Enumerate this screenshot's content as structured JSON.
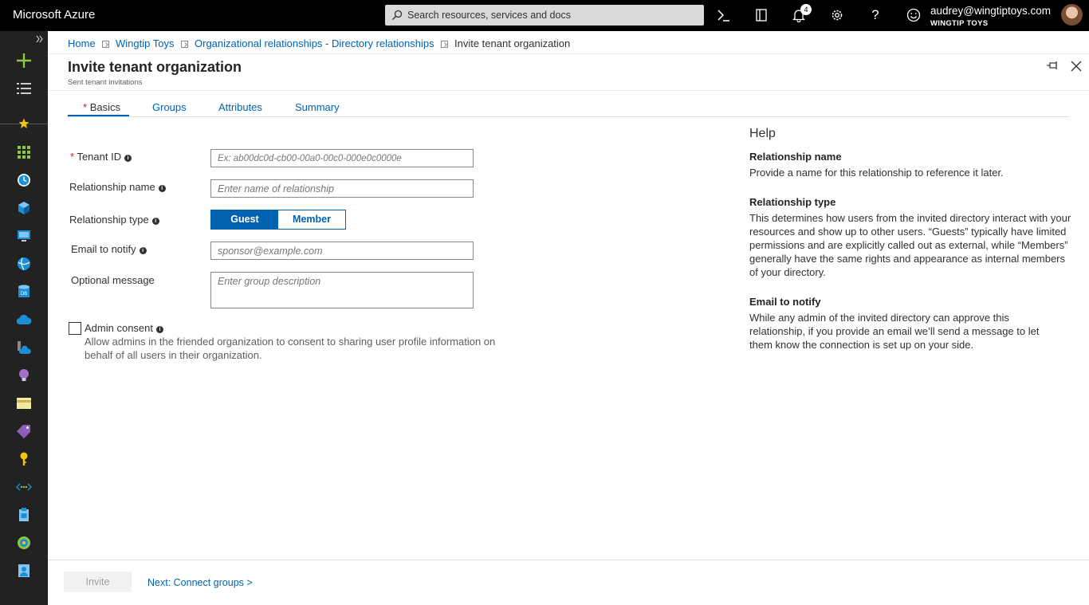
{
  "topbar": {
    "brand": "Microsoft Azure",
    "search_placeholder": "Search resources, services and docs",
    "notification_count": "4",
    "user_email": "audrey@wingtiptoys.com",
    "user_org": "WINGTIP TOYS"
  },
  "breadcrumb": {
    "items": [
      "Home",
      "Wingtip Toys",
      "Organizational relationships - Directory relationships"
    ],
    "current": "Invite tenant organization"
  },
  "page": {
    "title": "Invite tenant organization",
    "subtitle": "Sent tenant invitations"
  },
  "tabs": [
    {
      "label": "Basics",
      "required": "*"
    },
    {
      "label": "Groups"
    },
    {
      "label": "Attributes"
    },
    {
      "label": "Summary"
    }
  ],
  "form": {
    "tenant_id": {
      "required": "*",
      "label": "Tenant ID",
      "placeholder": "Ex: ab00dc0d-cb00-00a0-00c0-000e0c0000e"
    },
    "relationship_name": {
      "label": "Relationship name",
      "placeholder": "Enter name of relationship"
    },
    "relationship_type": {
      "label": "Relationship type",
      "options": [
        "Guest",
        "Member"
      ],
      "selected": "Guest"
    },
    "email": {
      "label": "Email to notify",
      "placeholder": "sponsor@example.com"
    },
    "message": {
      "label": "Optional message",
      "placeholder": "Enter group description"
    },
    "consent": {
      "label": "Admin consent",
      "checked": false,
      "description": "Allow admins in the friended organization to consent to sharing user profile information on behalf of all users in their organization."
    }
  },
  "help": {
    "title": "Help",
    "sections": [
      {
        "heading": "Relationship name",
        "body": "Provide a name for this relationship to reference it later."
      },
      {
        "heading": "Relationship type",
        "body": "This determines how users from the invited directory interact with your resources and show up to other users. “Guests” typically have limited permissions and are explicitly called out as external, while “Members” generally have the same rights and appearance as internal members of your directory."
      },
      {
        "heading": "Email to notify",
        "body": "While any admin of the invited directory can approve this relationship, if you provide an email we’ll send a message to let them know the connection is set up on your side."
      }
    ]
  },
  "footer": {
    "invite_label": "Invite",
    "next_label": "Next: Connect groups >"
  },
  "colors": {
    "accent": "#0063b1",
    "topbar": "#000000",
    "nav": "#222222",
    "required": "#e81123"
  }
}
